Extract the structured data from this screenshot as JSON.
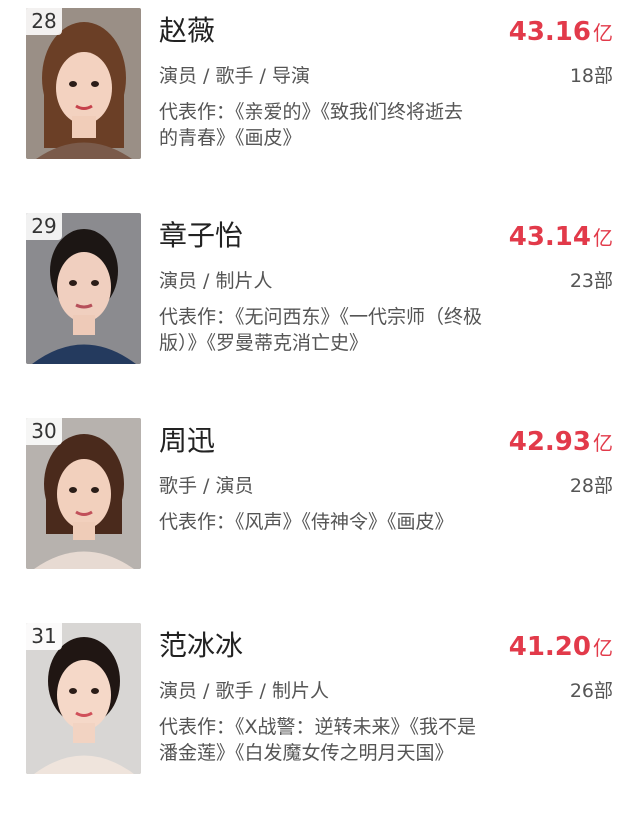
{
  "entries": [
    {
      "rank": "28",
      "name": "赵薇",
      "box_value": "43.16",
      "box_unit": "亿",
      "roles": "演员 / 歌手 / 导演",
      "count": "18部",
      "works_line1": "代表作：《亲爱的》《致我们终将逝去",
      "works_line2": "的青春》《画皮》"
    },
    {
      "rank": "29",
      "name": "章子怡",
      "box_value": "43.14",
      "box_unit": "亿",
      "roles": "演员 / 制片人",
      "count": "23部",
      "works_line1": "代表作：《无问西东》《一代宗师（终极",
      "works_line2": "版）》《罗曼蒂克消亡史》"
    },
    {
      "rank": "30",
      "name": "周迅",
      "box_value": "42.93",
      "box_unit": "亿",
      "roles": "歌手 / 演员",
      "count": "28部",
      "works_line1": "代表作：《风声》《侍神令》《画皮》",
      "works_line2": ""
    },
    {
      "rank": "31",
      "name": "范冰冰",
      "box_value": "41.20",
      "box_unit": "亿",
      "roles": "演员 / 歌手 / 制片人",
      "count": "26部",
      "works_line1": "代表作：《X战警：逆转未来》《我不是",
      "works_line2": "潘金莲》《白发魔女传之明月天国》"
    }
  ],
  "colors": {
    "box_value": "#e23a4a",
    "secondary_text": "#555555"
  }
}
